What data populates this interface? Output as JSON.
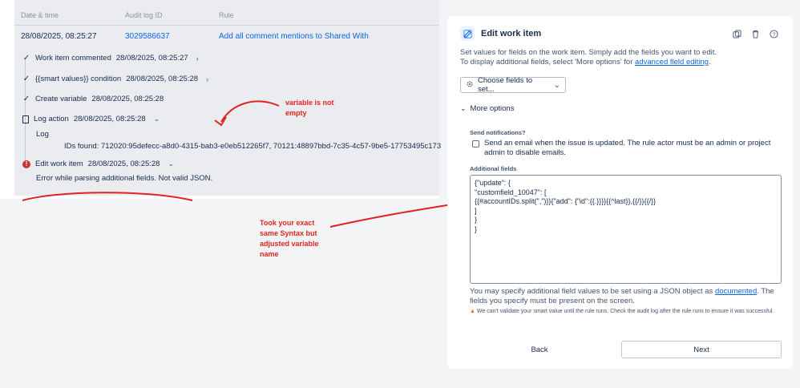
{
  "audit": {
    "columns": [
      "Date & time",
      "Audit log ID",
      "Rule"
    ],
    "row": {
      "datetime": "28/08/2025, 08:25:27",
      "log_id": "3029586637",
      "rule": "Add all comment mentions to Shared With"
    },
    "steps": [
      {
        "title": "Work item commented",
        "time": "28/08/2025, 08:25:27",
        "status": "success",
        "icon": "chevron-right-icon"
      },
      {
        "title": "{{smart values}} condition",
        "time": "28/08/2025, 08:25:28",
        "status": "success",
        "icon": "chevron-right-icon"
      },
      {
        "title": "Create variable",
        "time": "28/08/2025, 08:25:28",
        "status": "success",
        "icon": ""
      },
      {
        "title": "Log action",
        "time": "28/08/2025, 08:25:28",
        "status": "success",
        "icon": "chevron-down-icon"
      },
      {
        "title": "Edit work item",
        "time": "28/08/2025, 08:25:28",
        "status": "error",
        "icon": "chevron-down-icon"
      }
    ],
    "log_label": "Log",
    "log_value": "IDs found: 712020:95defecc-a8d0-4315-bab3-e0eb512265f7, 70121:48897bbd-7c35-4c57-9be5-17753495c173",
    "error_text": "Error while parsing additional fields. Not valid JSON."
  },
  "annotations": {
    "note1": "variable is not empty",
    "note2": "Took your exact same Syntax but adjusted variable name",
    "color": "#e0241f"
  },
  "panel": {
    "title": "Edit work item",
    "desc_line1": "Set values for fields on the work item. Simply add the fields you want to edit.",
    "desc_line2_pre": "To display additional fields, select 'More options' for ",
    "desc_link": "advanced field editing",
    "desc_line2_post": ".",
    "choose_label": "Choose fields to set...",
    "more_options": "More options",
    "send_label": "Send notifications?",
    "send_text": "Send an email when the issue is updated. The rule actor must be an admin or project admin to disable emails.",
    "additional_label": "Additional fields",
    "json_text": "{\"update\": {\n\"customfield_10047\": [\n{{#accountIDs.split(\",\")}}{\"add\": {\"id\":{{.}}}}{{^last}},{{/}}{{/}}\n]\n}\n}",
    "help_pre": "You may specify additional field values to be set using a JSON object as ",
    "help_link": "documented",
    "help_post": ". The fields you specify must be present on the screen.",
    "warning": "We can't validate your smart value until the rule runs. Check the audit log after the rule runs to ensure it was successful.",
    "back_label": "Back",
    "next_label": "Next",
    "accent": "#0c66e4"
  }
}
